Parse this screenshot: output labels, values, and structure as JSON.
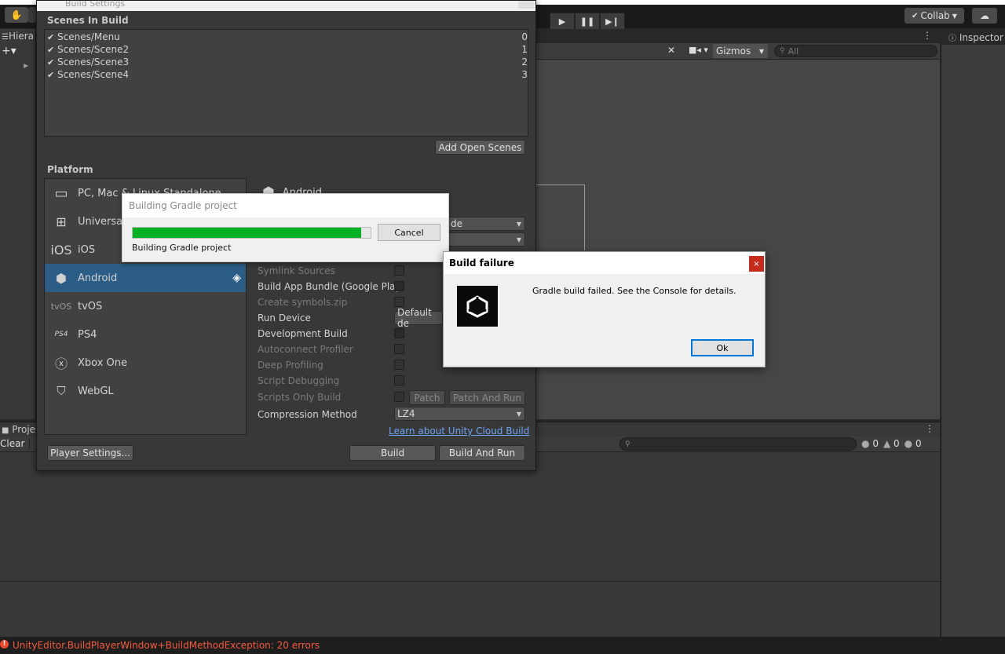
{
  "editor": {
    "collab_label": "Collab",
    "inspector_tab": "Inspector",
    "hierarchy_tab": "Hiera",
    "project_tab": "Proje",
    "scene_gizmos": "Gizmos",
    "scene_search_placeholder": "All",
    "console_clear": "Clear",
    "console_counts": {
      "errors": "0",
      "warnings": "0",
      "messages": "0"
    },
    "status_message": "UnityEditor.BuildPlayerWindow+BuildMethodException: 20 errors"
  },
  "build_settings": {
    "window_title": "Build Settings",
    "scenes_header": "Scenes In Build",
    "scenes": [
      {
        "name": "Scenes/Menu",
        "index": "0",
        "checked": true
      },
      {
        "name": "Scenes/Scene2",
        "index": "1",
        "checked": true
      },
      {
        "name": "Scenes/Scene3",
        "index": "2",
        "checked": true
      },
      {
        "name": "Scenes/Scene4",
        "index": "3",
        "checked": true
      }
    ],
    "add_open_scenes": "Add Open Scenes",
    "platform_header": "Platform",
    "platforms": [
      {
        "label": "PC, Mac & Linux Standalone",
        "icon": "monitor-icon"
      },
      {
        "label": "Universal Windows Platform",
        "icon": "windows-icon"
      },
      {
        "label": "iOS",
        "icon": "ios-icon",
        "icon_text": "iOS"
      },
      {
        "label": "Android",
        "icon": "android-icon",
        "selected": true
      },
      {
        "label": "tvOS",
        "icon": "tvos-icon",
        "icon_text": "tvOS"
      },
      {
        "label": "PS4",
        "icon": "ps4-icon",
        "icon_text": "PS4"
      },
      {
        "label": "Xbox One",
        "icon": "xbox-icon"
      },
      {
        "label": "WebGL",
        "icon": "html5-icon"
      }
    ],
    "selected_platform_title": "Android",
    "texture_dropdown_partial": "de",
    "options": [
      {
        "label": "Symlink Sources",
        "dim": true
      },
      {
        "label": "Build App Bundle (Google Play)",
        "dim": false
      },
      {
        "label": "Create symbols.zip",
        "dim": true
      },
      {
        "label": "Run Device",
        "dim": false
      },
      {
        "label": "Development Build",
        "dim": false
      },
      {
        "label": "Autoconnect Profiler",
        "dim": true
      },
      {
        "label": "Deep Profiling",
        "dim": true
      },
      {
        "label": "Script Debugging",
        "dim": true
      },
      {
        "label": "Scripts Only Build",
        "dim": true
      }
    ],
    "run_device_value": "Default de",
    "patch": "Patch",
    "patch_and_run": "Patch And Run",
    "compression_label": "Compression Method",
    "compression_value": "LZ4",
    "cloud_build_link": "Learn about Unity Cloud Build",
    "player_settings": "Player Settings...",
    "build": "Build",
    "build_and_run": "Build And Run"
  },
  "progress_dialog": {
    "title": "Building Gradle project",
    "status": "Building Gradle project",
    "cancel": "Cancel",
    "progress_percent": 96
  },
  "failure_dialog": {
    "title": "Build failure",
    "message": "Gradle build failed.  See the Console for details.",
    "ok": "Ok",
    "close": "×"
  }
}
